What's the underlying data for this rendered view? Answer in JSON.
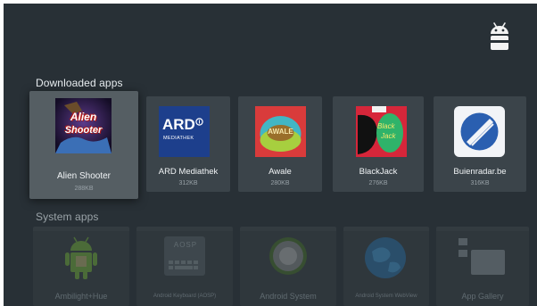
{
  "downloaded": {
    "title": "Downloaded apps",
    "apps": [
      {
        "name": "Alien Shooter",
        "size": "288KB",
        "icon": "alien-shooter-icon",
        "icon_text": "Alien Shooter"
      },
      {
        "name": "ARD Mediathek",
        "size": "312KB",
        "icon": "ard-mediathek-icon",
        "icon_text": "ARD",
        "icon_subtext": "MEDIATHEK"
      },
      {
        "name": "Awale",
        "size": "280KB",
        "icon": "awale-icon",
        "icon_text": "AWALE"
      },
      {
        "name": "BlackJack",
        "size": "276KB",
        "icon": "blackjack-icon",
        "icon_text": "Black Jack"
      },
      {
        "name": "Buienradar.be",
        "size": "316KB",
        "icon": "buienradar-icon"
      }
    ]
  },
  "system": {
    "title": "System apps",
    "apps": [
      {
        "name": "Ambilight+Hue",
        "icon": "android-robot-icon"
      },
      {
        "name": "Android Keyboard (AOSP)",
        "icon": "keyboard-icon",
        "icon_text": "AOSP"
      },
      {
        "name": "Android System",
        "icon": "system-dial-icon"
      },
      {
        "name": "Android System WebView",
        "icon": "globe-icon"
      },
      {
        "name": "App Gallery",
        "icon": "app-gallery-icon"
      }
    ]
  },
  "colors": {
    "background": "#283036",
    "tile": "#3b444a",
    "tile_focused": "#555e63",
    "ard_blue": "#1d3f8c",
    "awale_red": "#d93b3b",
    "blackjack_red": "#d6263a",
    "buienradar_blue": "#2a5fb0"
  }
}
